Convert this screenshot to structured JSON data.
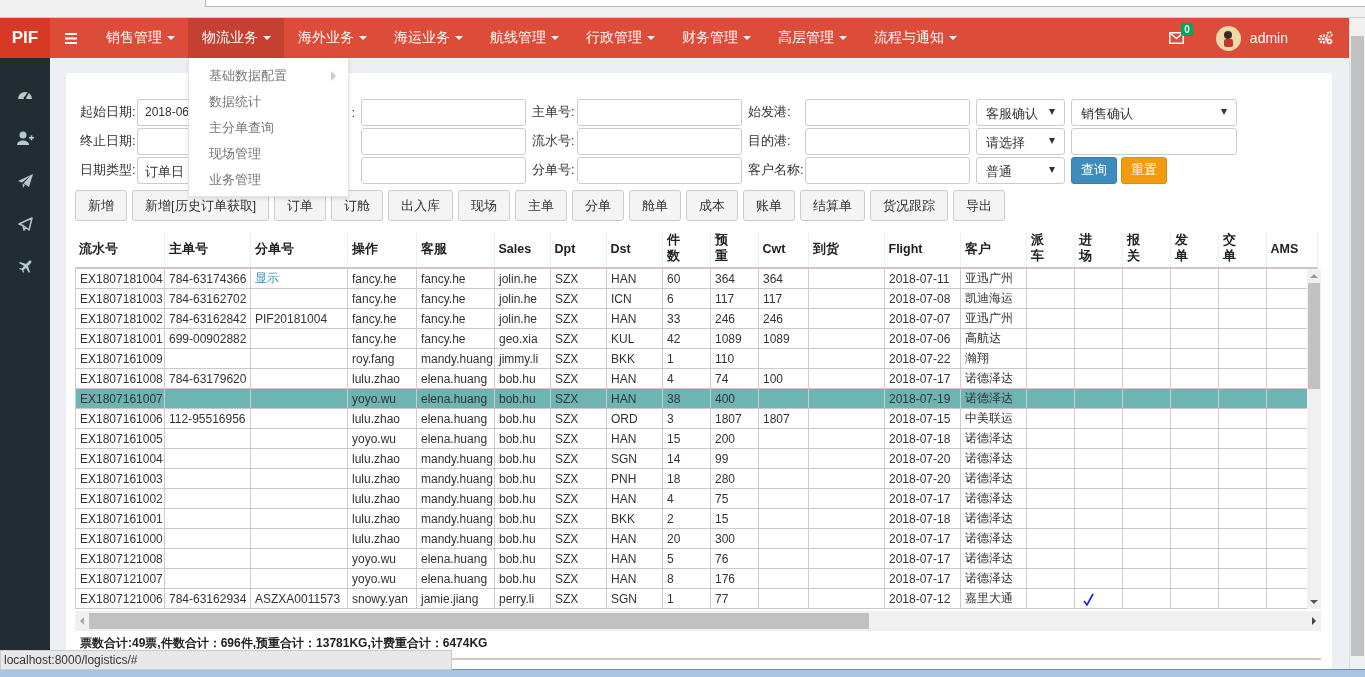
{
  "status_url": "localhost:8000/logistics/#",
  "nav": {
    "logo": "PIF",
    "mail_count": "0",
    "user": "admin",
    "items": [
      {
        "label": "销售管理",
        "selected": false
      },
      {
        "label": "物流业务",
        "selected": true,
        "menu": [
          {
            "label": "基础数据配置",
            "submenu": true
          },
          {
            "label": "数据统计",
            "submenu": false
          },
          {
            "label": "主分单查询",
            "submenu": false
          },
          {
            "label": "现场管理",
            "submenu": false
          },
          {
            "label": "业务管理",
            "submenu": false
          }
        ]
      },
      {
        "label": "海外业务",
        "selected": false
      },
      {
        "label": "海运业务",
        "selected": false
      },
      {
        "label": "航线管理",
        "selected": false
      },
      {
        "label": "行政管理",
        "selected": false
      },
      {
        "label": "财务管理",
        "selected": false
      },
      {
        "label": "高层管理",
        "selected": false
      },
      {
        "label": "流程与通知",
        "selected": false
      }
    ]
  },
  "sidebar": [
    {
      "kind": "dashboard"
    },
    {
      "kind": "user-add"
    },
    {
      "kind": "send"
    },
    {
      "kind": "send-outline"
    },
    {
      "kind": "plane"
    }
  ],
  "filters": [
    [
      {
        "kind": "input",
        "label": "起始日期:",
        "value": "2018-06"
      },
      {
        "kind": "input",
        "label": ":"
      },
      {
        "kind": "input",
        "label": "主单号:"
      },
      {
        "kind": "input",
        "label": "始发港:"
      },
      {
        "kind": "select",
        "value": "客服确认"
      },
      {
        "kind": "select",
        "value": "销售确认"
      }
    ],
    [
      {
        "kind": "input",
        "label": "终止日期:"
      },
      {
        "kind": "input"
      },
      {
        "kind": "input",
        "label": "流水号:"
      },
      {
        "kind": "input",
        "label": "目的港:"
      },
      {
        "kind": "select",
        "value": "请选择"
      },
      {
        "kind": "input"
      }
    ],
    [
      {
        "kind": "select",
        "label": "日期类型:",
        "value": "订单日"
      },
      {
        "kind": "input"
      },
      {
        "kind": "input",
        "label": "分单号:"
      },
      {
        "kind": "input",
        "label": "客户名称:"
      },
      {
        "kind": "select",
        "value": "普通"
      },
      {
        "kind": "buttons",
        "buttons": [
          {
            "label": "查询",
            "kind": "primary"
          },
          {
            "label": "重置",
            "kind": "warning"
          }
        ]
      }
    ]
  ],
  "actions": [
    "新增",
    "新增[历史订单获取]",
    "订单",
    "订舱",
    "出入库",
    "现场",
    "主单",
    "分单",
    "舱单",
    "成本",
    "账单",
    "结算单",
    "货况跟踪",
    "导出"
  ],
  "table": {
    "columns": [
      {
        "label": "流水号",
        "kind": "plain"
      },
      {
        "label": "主单号",
        "kind": "plain"
      },
      {
        "label": "分单号",
        "kind": "plain"
      },
      {
        "label": "操作",
        "kind": "plain"
      },
      {
        "label": "客服",
        "kind": "plain"
      },
      {
        "label": "Sales",
        "kind": "plain"
      },
      {
        "label": "Dpt",
        "kind": "plain"
      },
      {
        "label": "Dst",
        "kind": "plain"
      },
      {
        "label": "件数",
        "kind": "stacked"
      },
      {
        "label": "预重",
        "kind": "stacked"
      },
      {
        "label": "Cwt",
        "kind": "plain"
      },
      {
        "label": "到货",
        "kind": "plain"
      },
      {
        "label": "Flight",
        "kind": "plain"
      },
      {
        "label": "客户",
        "kind": "plain"
      },
      {
        "label": "派车",
        "kind": "stacked"
      },
      {
        "label": "进场",
        "kind": "stacked"
      },
      {
        "label": "报关",
        "kind": "stacked"
      },
      {
        "label": "发单",
        "kind": "stacked"
      },
      {
        "label": "交单",
        "kind": "stacked"
      },
      {
        "label": "AMS",
        "kind": "plain"
      }
    ],
    "rows": [
      {
        "selected": false,
        "yard_in": false,
        "cells": [
          "EX1807181004",
          "784-63174366",
          {
            "kind": "link",
            "text": "显示"
          },
          "fancy.he",
          "fancy.he",
          "jolin.he",
          "SZX",
          "HAN",
          "60",
          "364",
          "364",
          null,
          "2018-07-11",
          "亚迅广州"
        ]
      },
      {
        "selected": false,
        "yard_in": false,
        "cells": [
          "EX1807181003",
          "784-63162702",
          null,
          "fancy.he",
          "fancy.he",
          "jolin.he",
          "SZX",
          "ICN",
          "6",
          "117",
          "117",
          null,
          "2018-07-08",
          "凯迪海运"
        ]
      },
      {
        "selected": false,
        "yard_in": false,
        "cells": [
          "EX1807181002",
          "784-63162842",
          "PIF20181004",
          "fancy.he",
          "fancy.he",
          "jolin.he",
          "SZX",
          "HAN",
          "33",
          "246",
          "246",
          null,
          "2018-07-07",
          "亚迅广州"
        ]
      },
      {
        "selected": false,
        "yard_in": false,
        "cells": [
          "EX1807181001",
          "699-00902882",
          null,
          "fancy.he",
          "fancy.he",
          "geo.xia",
          "SZX",
          "KUL",
          "42",
          "1089",
          "1089",
          null,
          "2018-07-06",
          "高航达"
        ]
      },
      {
        "selected": false,
        "yard_in": false,
        "cells": [
          "EX1807161009",
          null,
          null,
          "roy.fang",
          "mandy.huang",
          "jimmy.li",
          "SZX",
          "BKK",
          "1",
          "110",
          null,
          null,
          "2018-07-22",
          "瀚翔"
        ]
      },
      {
        "selected": false,
        "yard_in": false,
        "cells": [
          "EX1807161008",
          "784-63179620",
          null,
          "lulu.zhao",
          "elena.huang",
          "bob.hu",
          "SZX",
          "HAN",
          "4",
          "74",
          "100",
          null,
          "2018-07-17",
          "诺德泽达"
        ]
      },
      {
        "selected": true,
        "yard_in": false,
        "cells": [
          "EX1807161007",
          null,
          null,
          "yoyo.wu",
          "elena.huang",
          "bob.hu",
          "SZX",
          "HAN",
          "38",
          "400",
          null,
          null,
          "2018-07-19",
          "诺德泽达"
        ]
      },
      {
        "selected": false,
        "yard_in": false,
        "cells": [
          "EX1807161006",
          "112-95516956",
          null,
          "lulu.zhao",
          "elena.huang",
          "bob.hu",
          "SZX",
          "ORD",
          "3",
          "1807",
          "1807",
          null,
          "2018-07-15",
          "中美联运"
        ]
      },
      {
        "selected": false,
        "yard_in": false,
        "cells": [
          "EX1807161005",
          null,
          null,
          "yoyo.wu",
          "elena.huang",
          "bob.hu",
          "SZX",
          "HAN",
          "15",
          "200",
          null,
          null,
          "2018-07-18",
          "诺德泽达"
        ]
      },
      {
        "selected": false,
        "yard_in": false,
        "cells": [
          "EX1807161004",
          null,
          null,
          "lulu.zhao",
          "mandy.huang",
          "bob.hu",
          "SZX",
          "SGN",
          "14",
          "99",
          null,
          null,
          "2018-07-20",
          "诺德泽达"
        ]
      },
      {
        "selected": false,
        "yard_in": false,
        "cells": [
          "EX1807161003",
          null,
          null,
          "lulu.zhao",
          "mandy.huang",
          "bob.hu",
          "SZX",
          "PNH",
          "18",
          "280",
          null,
          null,
          "2018-07-20",
          "诺德泽达"
        ]
      },
      {
        "selected": false,
        "yard_in": false,
        "cells": [
          "EX1807161002",
          null,
          null,
          "lulu.zhao",
          "mandy.huang",
          "bob.hu",
          "SZX",
          "HAN",
          "4",
          "75",
          null,
          null,
          "2018-07-17",
          "诺德泽达"
        ]
      },
      {
        "selected": false,
        "yard_in": false,
        "cells": [
          "EX1807161001",
          null,
          null,
          "lulu.zhao",
          "mandy.huang",
          "bob.hu",
          "SZX",
          "BKK",
          "2",
          "15",
          null,
          null,
          "2018-07-18",
          "诺德泽达"
        ]
      },
      {
        "selected": false,
        "yard_in": false,
        "cells": [
          "EX1807161000",
          null,
          null,
          "lulu.zhao",
          "mandy.huang",
          "bob.hu",
          "SZX",
          "HAN",
          "20",
          "300",
          null,
          null,
          "2018-07-17",
          "诺德泽达"
        ]
      },
      {
        "selected": false,
        "yard_in": false,
        "cells": [
          "EX1807121008",
          null,
          null,
          "yoyo.wu",
          "elena.huang",
          "bob.hu",
          "SZX",
          "HAN",
          "5",
          "76",
          null,
          null,
          "2018-07-17",
          "诺德泽达"
        ]
      },
      {
        "selected": false,
        "yard_in": false,
        "cells": [
          "EX1807121007",
          null,
          null,
          "yoyo.wu",
          "elena.huang",
          "bob.hu",
          "SZX",
          "HAN",
          "8",
          "176",
          null,
          null,
          "2018-07-17",
          "诺德泽达"
        ]
      },
      {
        "selected": false,
        "yard_in": true,
        "cells": [
          "EX1807121006",
          "784-63162934",
          "ASZXA0011573",
          "snowy.yan",
          "jamie.jiang",
          "perry.li",
          "SZX",
          "SGN",
          "1",
          "77",
          null,
          null,
          "2018-07-12",
          "嘉里大通"
        ]
      }
    ],
    "summary": "票数合计:49票,件数合计：696件,预重合计：13781KG,计费重合计：6474KG"
  }
}
